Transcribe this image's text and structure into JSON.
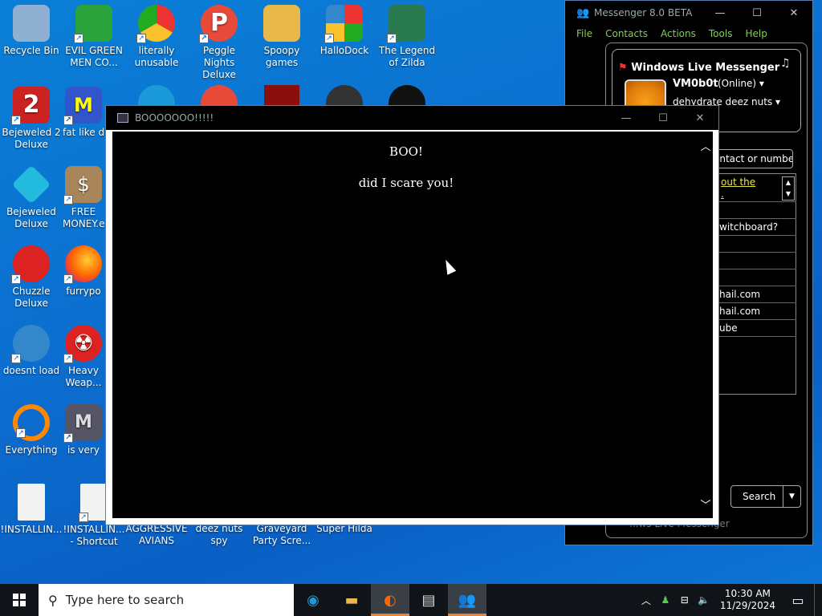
{
  "desktop": {
    "icons": [
      {
        "label": "Recycle Bin",
        "glyph": "🗑",
        "color": "#9ab"
      },
      {
        "label": "EVIL GREEN MEN CO...",
        "glyph": "👥",
        "color": "#2a2"
      },
      {
        "label": "literally unusable",
        "glyph": "◉",
        "color": "#f7c22b"
      },
      {
        "label": "Peggle Nights Deluxe",
        "glyph": "P",
        "color": "#e33"
      },
      {
        "label": "Spoopy games",
        "glyph": "📁",
        "color": "#e8b84a"
      },
      {
        "label": "HalloDock",
        "glyph": "⛨",
        "color": "#3b8"
      },
      {
        "label": "The Legend of Zilda",
        "glyph": "☺",
        "color": "#2a6"
      },
      {
        "label": "Bejeweled 2 Deluxe",
        "glyph": "2",
        "color": "#c22"
      },
      {
        "label": "fat like da",
        "glyph": "M",
        "color": "#35c"
      },
      {
        "label": "Bejeweled Deluxe",
        "glyph": "◆",
        "color": "#2bd"
      },
      {
        "label": "FREE MONEY.e",
        "glyph": "$",
        "color": "#a86"
      },
      {
        "label": "Chuzzle Deluxe",
        "glyph": "●",
        "color": "#d22"
      },
      {
        "label": "furrypo",
        "glyph": "◐",
        "color": "#f60"
      },
      {
        "label": "doesnt load",
        "glyph": "◕",
        "color": "#38c"
      },
      {
        "label": "Heavy Weap...",
        "glyph": "☢",
        "color": "#d22"
      },
      {
        "label": "Everything",
        "glyph": "⚲",
        "color": "#f80"
      },
      {
        "label": "is very",
        "glyph": "M",
        "color": "#556"
      },
      {
        "label": "!INSTALLIN...",
        "glyph": "📄",
        "color": "#eee"
      },
      {
        "label": "!INSTALLIN... - Shortcut",
        "glyph": "📄",
        "color": "#eee"
      },
      {
        "label": "AGGRESSIVE AVIANS",
        "glyph": "",
        "color": "#0a7fd6"
      },
      {
        "label": "deez nuts spy",
        "glyph": "",
        "color": "#0a7fd6"
      },
      {
        "label": "Graveyard Party Scre...",
        "glyph": "",
        "color": "#0a7fd6"
      },
      {
        "label": "Super Hilda",
        "glyph": "",
        "color": "#0a7fd6"
      }
    ]
  },
  "messenger": {
    "title": "Messenger 8.0 BETA",
    "menu": [
      "File",
      "Contacts",
      "Actions",
      "Tools",
      "Help"
    ],
    "brand": "Windows Live Messenger",
    "user_name": "VM0b0t",
    "status": "(Online) ▾",
    "personal_message": "dehydrate deez nuts ▾",
    "search_placeholder": "ontact or numbe",
    "ad_link": "out the",
    "ad_link2": ".",
    "rows": [
      "",
      "witchboard?",
      "",
      "",
      "",
      "hail.com",
      "hail.com",
      "ube",
      ""
    ],
    "search_button": "Search",
    "footer": "...ws Live Messenger"
  },
  "popup": {
    "title": "BOOOOOOO!!!!!",
    "heading": "BOO!",
    "message": "did I scare you!"
  },
  "taskbar": {
    "search_placeholder": "Type here to search",
    "time": "10:30 AM",
    "date": "11/29/2024"
  }
}
